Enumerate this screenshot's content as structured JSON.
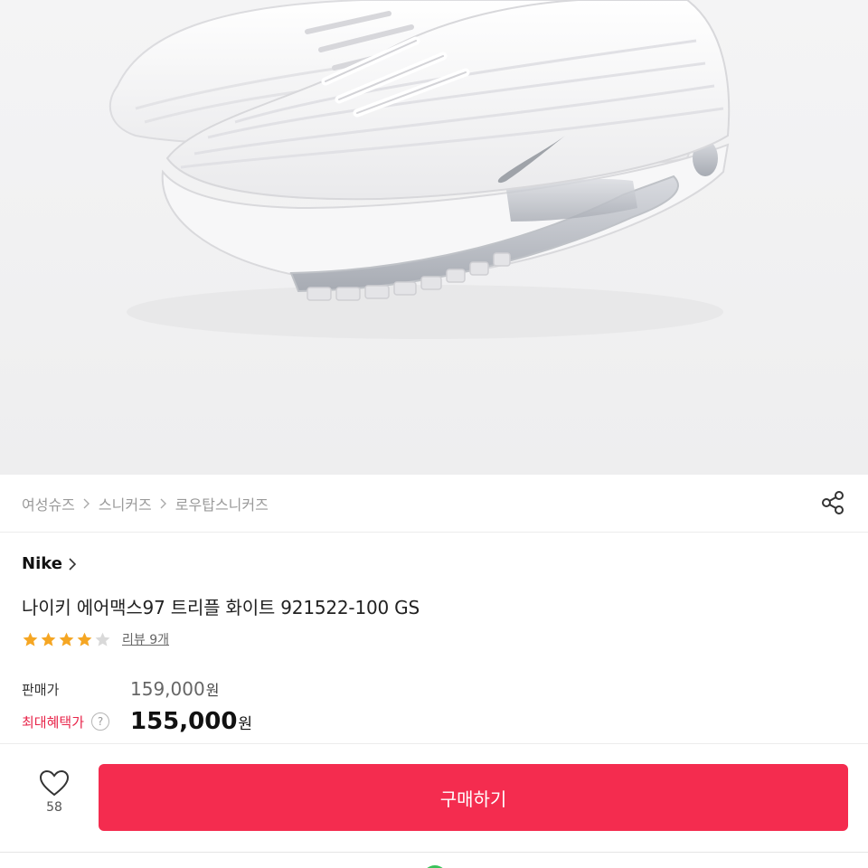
{
  "product_image": {
    "alt": "white sneaker"
  },
  "breadcrumb": {
    "items": [
      "여성슈즈",
      "스니커즈",
      "로우탑스니커즈"
    ]
  },
  "brand": {
    "name": "Nike"
  },
  "product": {
    "title": "나이키 에어맥스97 트리플 화이트 921522-100 GS"
  },
  "rating": {
    "stars": 4,
    "max": 5,
    "review_label": "리뷰 9개"
  },
  "price": {
    "sale_label": "판매가",
    "sale_value": "159,000",
    "best_label": "최대혜택가",
    "best_value": "155,000",
    "currency": "원",
    "help": "?"
  },
  "actions": {
    "wish_count": "58",
    "buy_label": "구매하기"
  },
  "colors": {
    "accent": "#f42c4f",
    "star": "#f5a623",
    "label_red": "#e8254a",
    "status_green": "#3ac25a"
  }
}
